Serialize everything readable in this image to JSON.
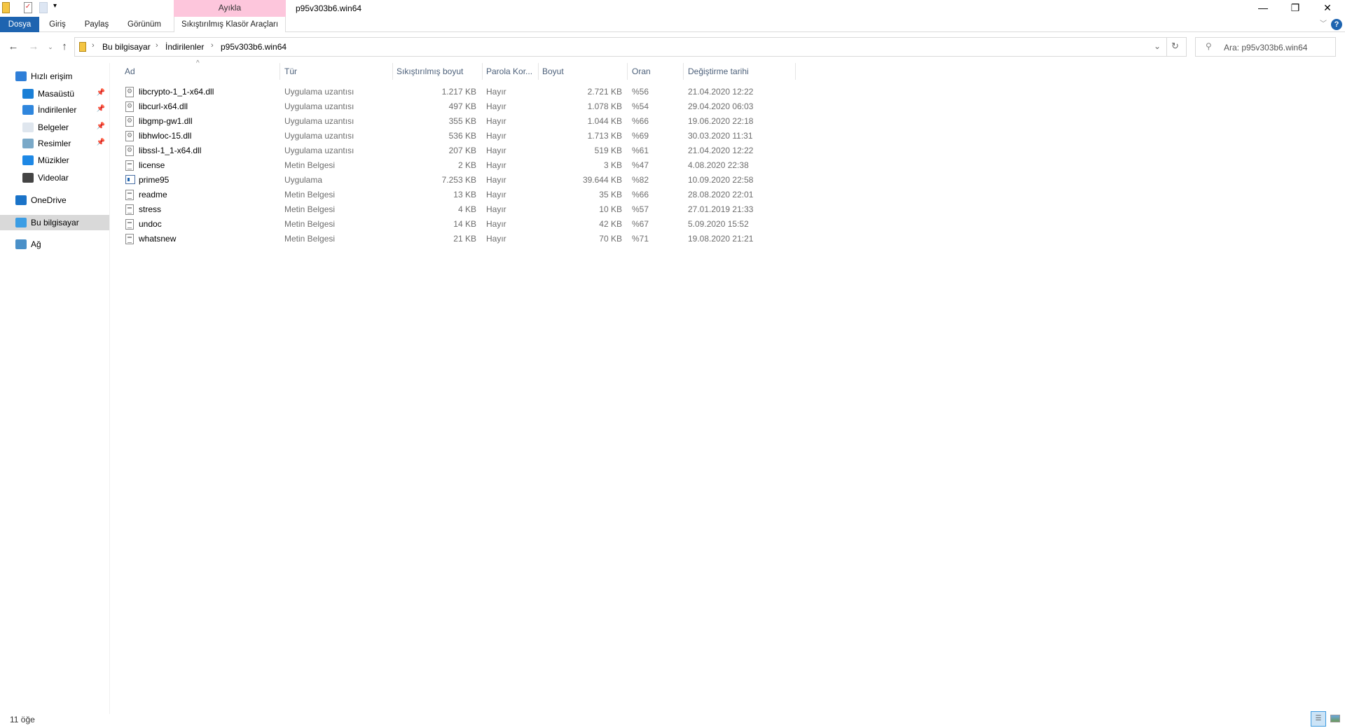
{
  "window": {
    "title": "p95v303b6.win64",
    "context_tab": "Ayıkla"
  },
  "ribbon": {
    "tabs": [
      "Dosya",
      "Giriş",
      "Paylaş",
      "Görünüm",
      "Sıkıştırılmış Klasör Araçları"
    ]
  },
  "address": {
    "crumbs": [
      "Bu bilgisayar",
      "İndirilenler",
      "p95v303b6.win64"
    ]
  },
  "search": {
    "placeholder": "Ara: p95v303b6.win64"
  },
  "sidebar": {
    "items": [
      {
        "label": "Hızlı erişim",
        "icon": "star-icon",
        "pinned": false
      },
      {
        "label": "Masaüstü",
        "icon": "desktop-icon",
        "pinned": true
      },
      {
        "label": "İndirilenler",
        "icon": "download-icon",
        "pinned": true
      },
      {
        "label": "Belgeler",
        "icon": "documents-icon",
        "pinned": true
      },
      {
        "label": "Resimler",
        "icon": "pictures-icon",
        "pinned": true
      },
      {
        "label": "Müzikler",
        "icon": "music-icon",
        "pinned": false
      },
      {
        "label": "Videolar",
        "icon": "videos-icon",
        "pinned": false
      },
      {
        "label": "OneDrive",
        "icon": "cloud-icon",
        "pinned": false
      },
      {
        "label": "Bu bilgisayar",
        "icon": "computer-icon",
        "pinned": false,
        "selected": true
      },
      {
        "label": "Ağ",
        "icon": "network-icon",
        "pinned": false
      }
    ]
  },
  "columns": [
    "Ad",
    "Tür",
    "Sıkıştırılmış boyut",
    "Parola Kor...",
    "Boyut",
    "Oran",
    "Değiştirme tarihi"
  ],
  "files": [
    {
      "name": "libcrypto-1_1-x64.dll",
      "type": "Uygulama uzantısı",
      "packed": "1.217 KB",
      "password": "Hayır",
      "size": "2.721 KB",
      "ratio": "%56",
      "date": "21.04.2020 12:22",
      "kind": "dll"
    },
    {
      "name": "libcurl-x64.dll",
      "type": "Uygulama uzantısı",
      "packed": "497 KB",
      "password": "Hayır",
      "size": "1.078 KB",
      "ratio": "%54",
      "date": "29.04.2020 06:03",
      "kind": "dll"
    },
    {
      "name": "libgmp-gw1.dll",
      "type": "Uygulama uzantısı",
      "packed": "355 KB",
      "password": "Hayır",
      "size": "1.044 KB",
      "ratio": "%66",
      "date": "19.06.2020 22:18",
      "kind": "dll"
    },
    {
      "name": "libhwloc-15.dll",
      "type": "Uygulama uzantısı",
      "packed": "536 KB",
      "password": "Hayır",
      "size": "1.713 KB",
      "ratio": "%69",
      "date": "30.03.2020 11:31",
      "kind": "dll"
    },
    {
      "name": "libssl-1_1-x64.dll",
      "type": "Uygulama uzantısı",
      "packed": "207 KB",
      "password": "Hayır",
      "size": "519 KB",
      "ratio": "%61",
      "date": "21.04.2020 12:22",
      "kind": "dll"
    },
    {
      "name": "license",
      "type": "Metin Belgesi",
      "packed": "2 KB",
      "password": "Hayır",
      "size": "3 KB",
      "ratio": "%47",
      "date": "4.08.2020 22:38",
      "kind": "txt"
    },
    {
      "name": "prime95",
      "type": "Uygulama",
      "packed": "7.253 KB",
      "password": "Hayır",
      "size": "39.644 KB",
      "ratio": "%82",
      "date": "10.09.2020 22:58",
      "kind": "exe"
    },
    {
      "name": "readme",
      "type": "Metin Belgesi",
      "packed": "13 KB",
      "password": "Hayır",
      "size": "35 KB",
      "ratio": "%66",
      "date": "28.08.2020 22:01",
      "kind": "txt"
    },
    {
      "name": "stress",
      "type": "Metin Belgesi",
      "packed": "4 KB",
      "password": "Hayır",
      "size": "10 KB",
      "ratio": "%57",
      "date": "27.01.2019 21:33",
      "kind": "txt"
    },
    {
      "name": "undoc",
      "type": "Metin Belgesi",
      "packed": "14 KB",
      "password": "Hayır",
      "size": "42 KB",
      "ratio": "%67",
      "date": "5.09.2020 15:52",
      "kind": "txt"
    },
    {
      "name": "whatsnew",
      "type": "Metin Belgesi",
      "packed": "21 KB",
      "password": "Hayır",
      "size": "70 KB",
      "ratio": "%71",
      "date": "19.08.2020 21:21",
      "kind": "txt"
    }
  ],
  "status": {
    "count": "11 öğe"
  },
  "colors": {
    "accent": "#1e64b0",
    "context_tab": "#fdc6dc",
    "selected": "#d9d9d9",
    "header_text": "#4c607a"
  }
}
